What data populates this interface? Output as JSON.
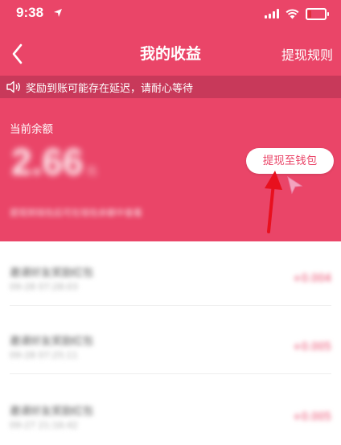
{
  "status_bar": {
    "time": "9:38"
  },
  "nav": {
    "title": "我的收益",
    "rules_link": "提现规则"
  },
  "notice": {
    "text": "奖励到账可能存在延迟，请耐心等待"
  },
  "balance": {
    "label": "当前余额",
    "amount": "2.66",
    "unit": "元",
    "note": "提现到钱包后可在钱包余额中查看",
    "withdraw_button": "提现至钱包"
  },
  "records": [
    {
      "title": "邀请好友奖励红包",
      "date": "09-28 07:28:03",
      "amount": "+0.004"
    },
    {
      "title": "邀请好友奖励红包",
      "date": "09-28 07:25:11",
      "amount": "+0.005"
    },
    {
      "title": "邀请好友奖励红包",
      "date": "09-27 21:16:42",
      "amount": "+0.005"
    }
  ],
  "colors": {
    "brand": "#ea4568",
    "notice_bg": "#c8395a",
    "annotation": "#e8101e"
  }
}
